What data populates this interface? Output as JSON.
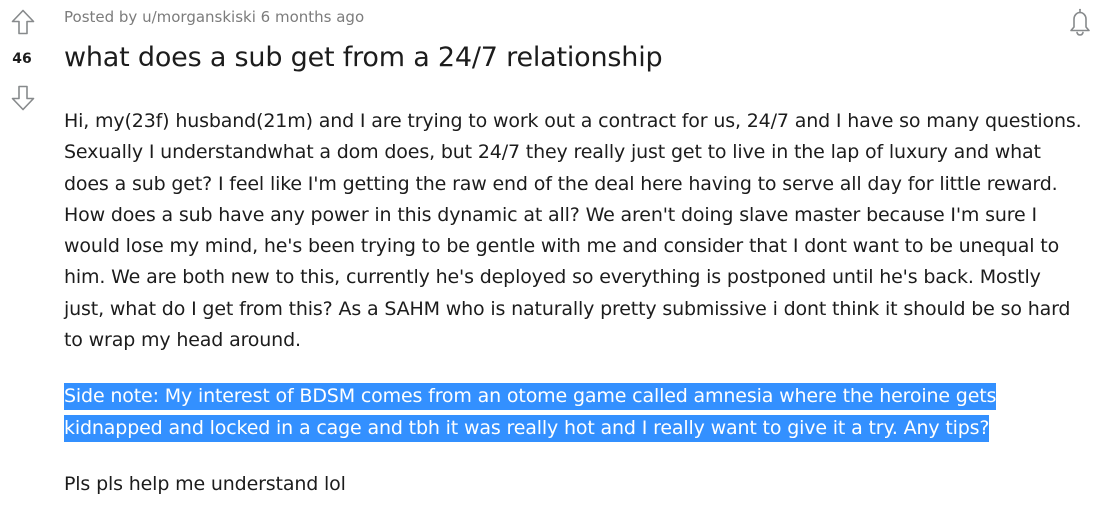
{
  "post": {
    "score": "46",
    "meta": "Posted by u/morganskiski 6 months ago",
    "title": "what does a sub get from a 24/7 relationship",
    "body": [
      "Hi, my(23f) husband(21m) and I are trying to work out a contract for us, 24/7 and I have so many questions. Sexually I understandwhat a dom does, but 24/7 they really just get to live in the lap of luxury and what does a sub get? I feel like I'm getting the raw end of the deal here having to serve all day for little reward. How does a sub have any power in this dynamic at all? We aren't doing slave master because I'm sure I would lose my mind, he's been trying to be gentle with me and consider that I dont want to be unequal to him. We are both new to this, currently he's deployed so everything is postponed until he's back. Mostly just, what do I get from this? As a SAHM who is naturally pretty submissive i dont think it should be so hard to wrap my head around.",
      "Side note: My interest of BDSM comes from an otome game called amnesia where the heroine gets kidnapped and locked in a cage and tbh it was really hot and I really want to give it a try. Any tips?",
      "Pls pls help me understand lol"
    ]
  },
  "icons": {
    "upvote": "arrow-up-outline-icon",
    "downvote": "arrow-down-outline-icon",
    "bell": "bell-icon"
  },
  "colors": {
    "selection_highlight": "#3390ff",
    "meta_text": "#7c7c7c",
    "icon_stroke": "#878a8c"
  }
}
